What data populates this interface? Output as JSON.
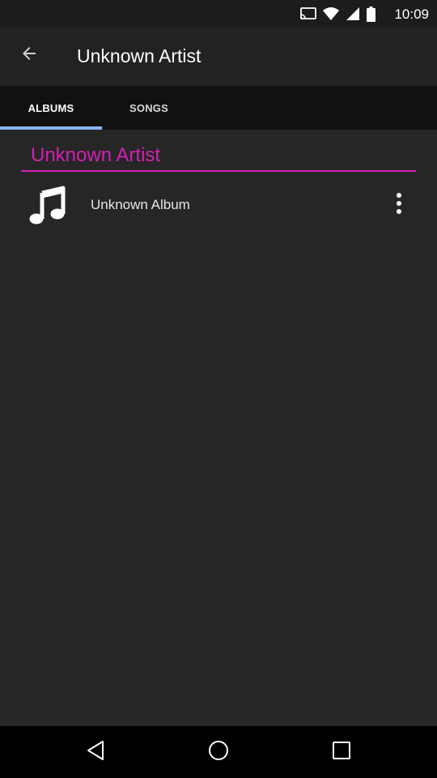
{
  "status_bar": {
    "time": "10:09",
    "icons": [
      "cast-icon",
      "wifi-icon",
      "signal-icon",
      "battery-icon"
    ]
  },
  "app_bar": {
    "title": "Unknown Artist",
    "back_icon": "arrow-back-icon"
  },
  "tabs": [
    {
      "label": "ALBUMS",
      "selected": true
    },
    {
      "label": "SONGS",
      "selected": false
    }
  ],
  "section": {
    "header": "Unknown Artist"
  },
  "albums": [
    {
      "title": "Unknown Album",
      "icon": "music-note-icon",
      "menu_icon": "more-vert-icon"
    }
  ],
  "nav_bar": {
    "icons": [
      "nav-back-icon",
      "nav-home-icon",
      "nav-recents-icon"
    ]
  },
  "colors": {
    "accent": "#d41fb4",
    "tab_indicator": "#8ab4f8",
    "background": "#262626",
    "app_bar": "#222222",
    "tab_bar": "#111111"
  }
}
